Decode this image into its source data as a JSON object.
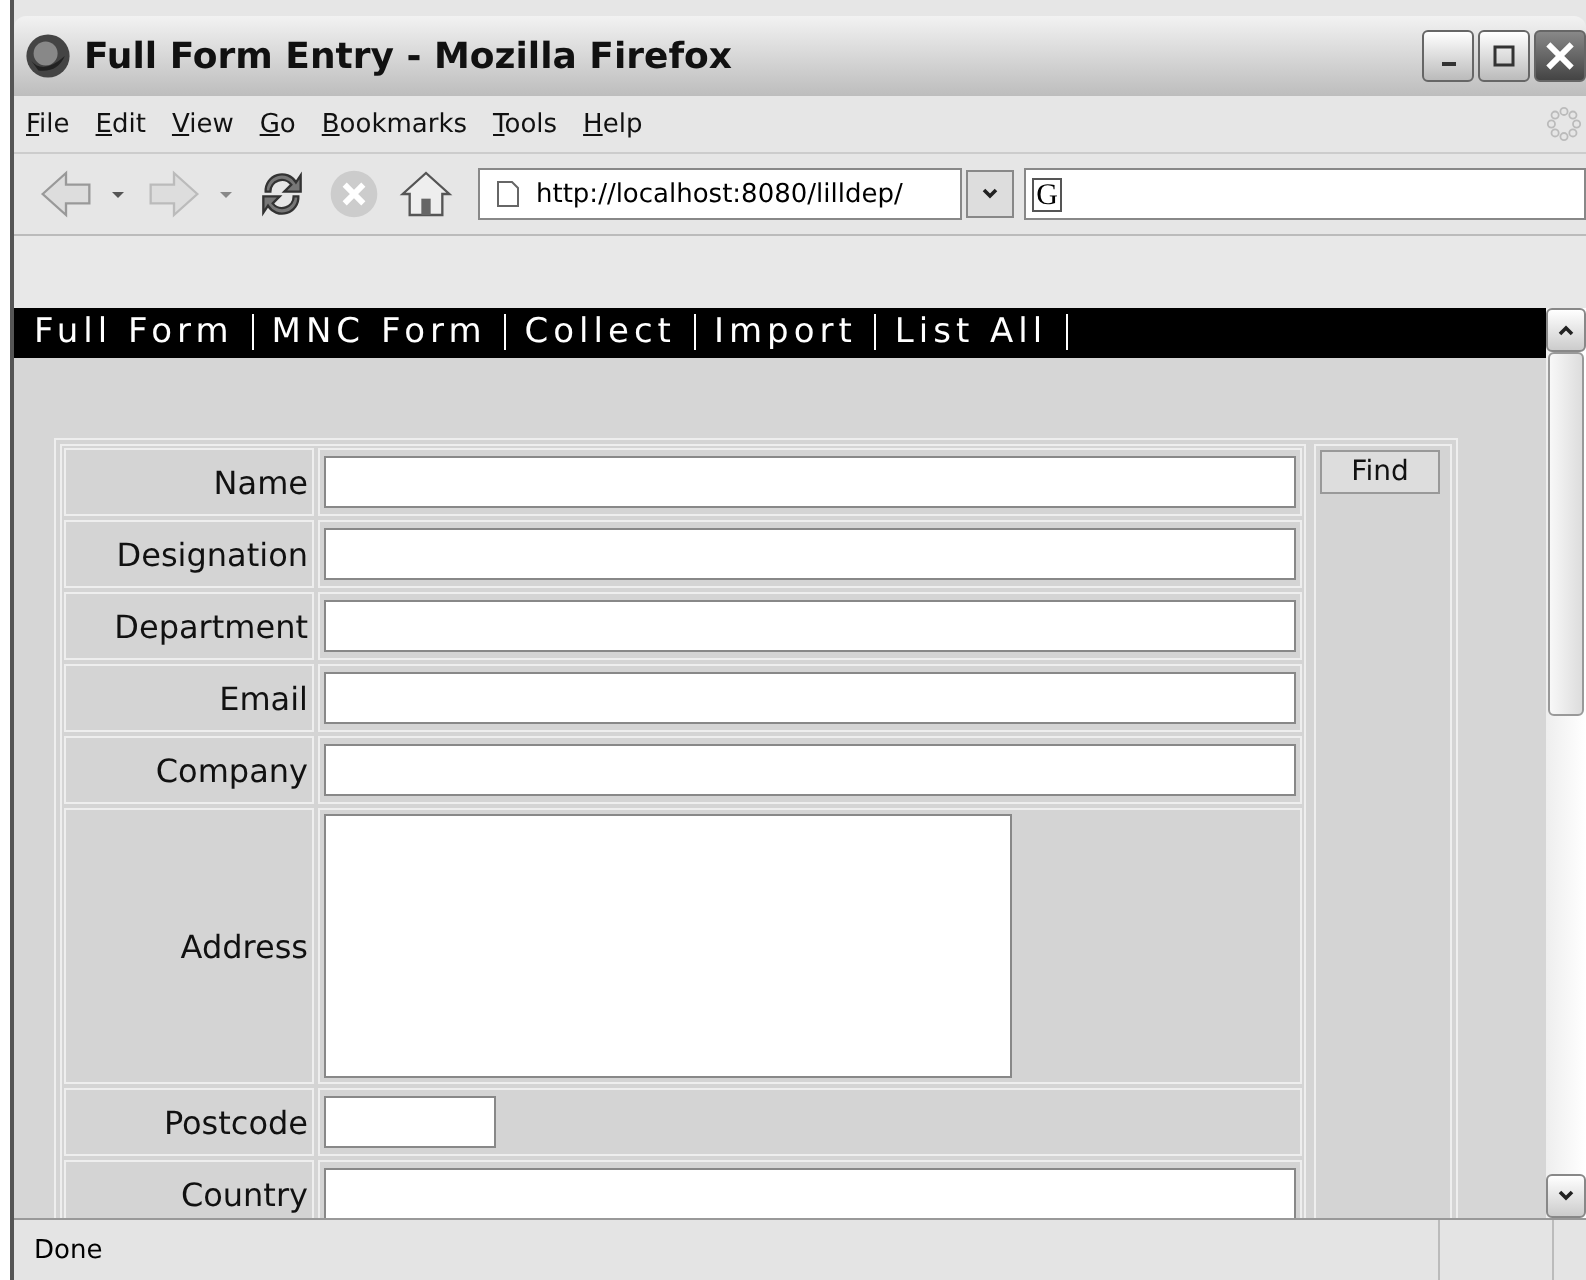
{
  "window": {
    "title": "Full Form Entry - Mozilla Firefox"
  },
  "menu": [
    "File",
    "Edit",
    "View",
    "Go",
    "Bookmarks",
    "Tools",
    "Help"
  ],
  "address_bar": {
    "value": "http://localhost:8080/lilldep/"
  },
  "search_bar": {
    "engine_glyph": "G"
  },
  "nav": [
    "Full Form",
    "MNC Form",
    "Collect",
    "Import",
    "List All"
  ],
  "form": {
    "fields": [
      {
        "label": "Name",
        "kind": "text"
      },
      {
        "label": "Designation",
        "kind": "text"
      },
      {
        "label": "Department",
        "kind": "text"
      },
      {
        "label": "Email",
        "kind": "text"
      },
      {
        "label": "Company",
        "kind": "text"
      },
      {
        "label": "Address",
        "kind": "textarea"
      },
      {
        "label": "Postcode",
        "kind": "short"
      },
      {
        "label": "Country",
        "kind": "text"
      }
    ],
    "find_button": "Find"
  },
  "status_bar": "Done"
}
